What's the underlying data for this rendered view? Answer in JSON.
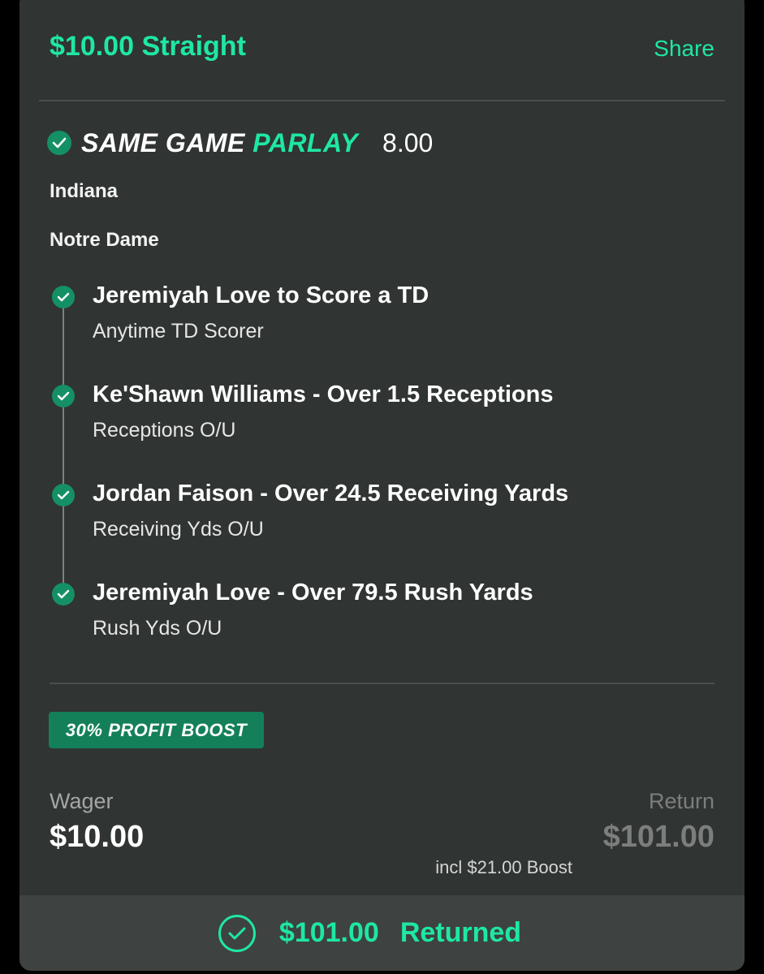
{
  "bet": {
    "title": "$10.00 Straight",
    "share_label": "Share"
  },
  "parlay": {
    "label_white": "SAME GAME",
    "label_green": "PARLAY",
    "odds": "8.00"
  },
  "teams": [
    "Indiana",
    "Notre Dame"
  ],
  "legs": [
    {
      "title": "Jeremiyah Love to Score a TD",
      "market": "Anytime TD Scorer"
    },
    {
      "title": "Ke'Shawn Williams - Over 1.5 Receptions",
      "market": "Receptions O/U"
    },
    {
      "title": "Jordan Faison - Over 24.5 Receiving Yards",
      "market": "Receiving Yds O/U"
    },
    {
      "title": "Jeremiyah Love - Over 79.5 Rush Yards",
      "market": "Rush Yds O/U"
    }
  ],
  "boost": {
    "label": "30% PROFIT BOOST",
    "note": "incl $21.00 Boost"
  },
  "wager": {
    "label": "Wager",
    "value": "$10.00"
  },
  "return": {
    "label": "Return",
    "value": "$101.00"
  },
  "result": {
    "amount": "$101.00",
    "status": "Returned"
  },
  "colors": {
    "accent": "#1ee7a4",
    "check": "#159065",
    "card": "#303433",
    "footer": "#3e4241",
    "badge": "#14805a"
  },
  "icons": {
    "sgp_status": "check-circle-icon",
    "leg_status": "check-circle-icon",
    "result_status": "check-circle-outline-icon"
  }
}
